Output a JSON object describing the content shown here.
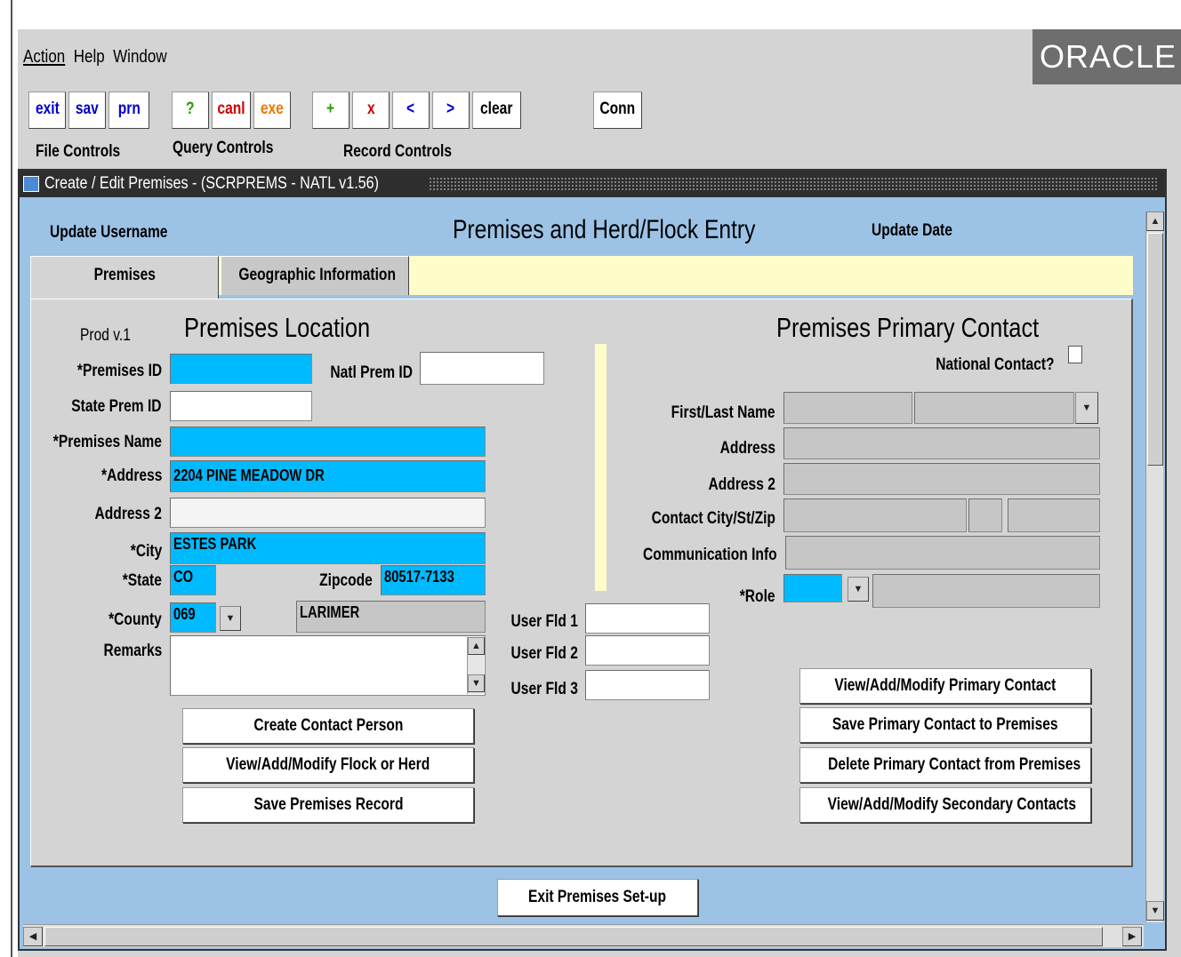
{
  "menu": {
    "action": "Action",
    "help": "Help",
    "window": "Window"
  },
  "brand": "ORACLE",
  "toolbar": {
    "exit": "exit",
    "sav": "sav",
    "prn": "prn",
    "query": "?",
    "canl": "canl",
    "exe": "exe",
    "add": "+",
    "del": "x",
    "prev": "<",
    "next": ">",
    "clear": "clear",
    "conn": "Conn",
    "file_controls": "File Controls",
    "query_controls": "Query Controls",
    "record_controls": "Record Controls"
  },
  "window_title": "Create / Edit Premises - (SCRPREMS - NATL v1.56)",
  "header": {
    "update_username": "Update Username",
    "title": "Premises and Herd/Flock Entry",
    "update_date": "Update Date"
  },
  "tabs": [
    {
      "label": "Premises"
    },
    {
      "label": "Geographic Information"
    }
  ],
  "left": {
    "version": "Prod v.1",
    "heading": "Premises Location",
    "premises_id_label": "*Premises ID",
    "premises_id": "",
    "natl_prem_id_label": "Natl Prem ID",
    "natl_prem_id": "",
    "state_prem_id_label": "State Prem ID",
    "state_prem_id": "",
    "premises_name_label": "*Premises Name",
    "premises_name": "",
    "address_label": "*Address",
    "address": "2204 PINE MEADOW DR",
    "address2_label": "Address 2",
    "address2": "",
    "city_label": "*City",
    "city": "ESTES PARK",
    "state_label": "*State",
    "state": "CO",
    "zip_label": "Zipcode",
    "zip": "80517-7133",
    "county_label": "*County",
    "county_code": "069",
    "county_name": "LARIMER",
    "remarks_label": "Remarks",
    "remarks": ""
  },
  "user_fields": [
    {
      "label": "User Fld 1",
      "value": ""
    },
    {
      "label": "User Fld 2",
      "value": ""
    },
    {
      "label": "User Fld 3",
      "value": ""
    }
  ],
  "right": {
    "heading": "Premises Primary Contact",
    "national_contact_label": "National Contact?",
    "first_last_label": "First/Last Name",
    "address_label": "Address",
    "address2_label": "Address 2",
    "city_label": "Contact City/St/Zip",
    "comm_label": "Communication Info",
    "role_label": "*Role"
  },
  "left_buttons": [
    "Create Contact Person",
    "View/Add/Modify Flock or Herd",
    "Save Premises Record"
  ],
  "right_buttons": [
    "View/Add/Modify Primary Contact",
    "Save Primary Contact to Premises",
    "Delete Primary Contact from Premises",
    "View/Add/Modify Secondary Contacts"
  ],
  "exit_button": "Exit Premises Set-up",
  "colors": {
    "required": "#00baff",
    "readonly": "#c6c6c6",
    "title_bar": "#2e2e2e",
    "canvas": "#9cc3e6",
    "tab_strip": "#fefcc8"
  }
}
